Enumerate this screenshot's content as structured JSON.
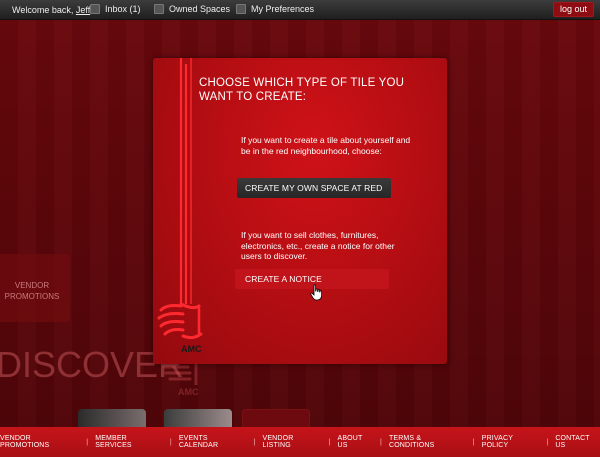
{
  "topbar": {
    "welcome_prefix": "Welcome back, ",
    "user_name": "Jeff",
    "nav": [
      {
        "label": "Inbox (1)"
      },
      {
        "label": "Owned Spaces"
      },
      {
        "label": "My Preferences"
      }
    ],
    "logout_label": "log out"
  },
  "background": {
    "vendor_tile_label_1": "VENDOR",
    "vendor_tile_label_2": "PROMOTIONS",
    "discover_text": "DISCOVER",
    "logo_text": "AMC"
  },
  "modal": {
    "title_line1": "CHOOSE WHICH TYPE OF TILE YOU",
    "title_line2": "WANT TO CREATE:",
    "own_space": {
      "description": "If you want to create a tile about yourself and be in the red neighbourhood, choose:",
      "button_label": "CREATE MY OWN SPACE AT RED"
    },
    "notice": {
      "description": "If you want to sell clothes, furnitures, electronics, etc., create a notice for other users to discover.",
      "button_label": "CREATE A NOTICE"
    },
    "logo_text": "AMC"
  },
  "footer": {
    "links": [
      {
        "label": "VENDOR PROMOTIONS"
      },
      {
        "label": "MEMBER SERVICES"
      },
      {
        "label": "EVENTS CALENDAR"
      },
      {
        "label": "VENDOR LISTING"
      },
      {
        "label": "ABOUT US"
      },
      {
        "label": "TERMS & CONDITIONS"
      },
      {
        "label": "PRIVACY POLICY"
      },
      {
        "label": "CONTACT US"
      }
    ],
    "separator": "|"
  },
  "colors": {
    "background": "#5e070b",
    "modal": "#b00d12",
    "footer": "#c6141a",
    "dark_button": "#2f2f2f",
    "logout": "#8d0d12"
  }
}
